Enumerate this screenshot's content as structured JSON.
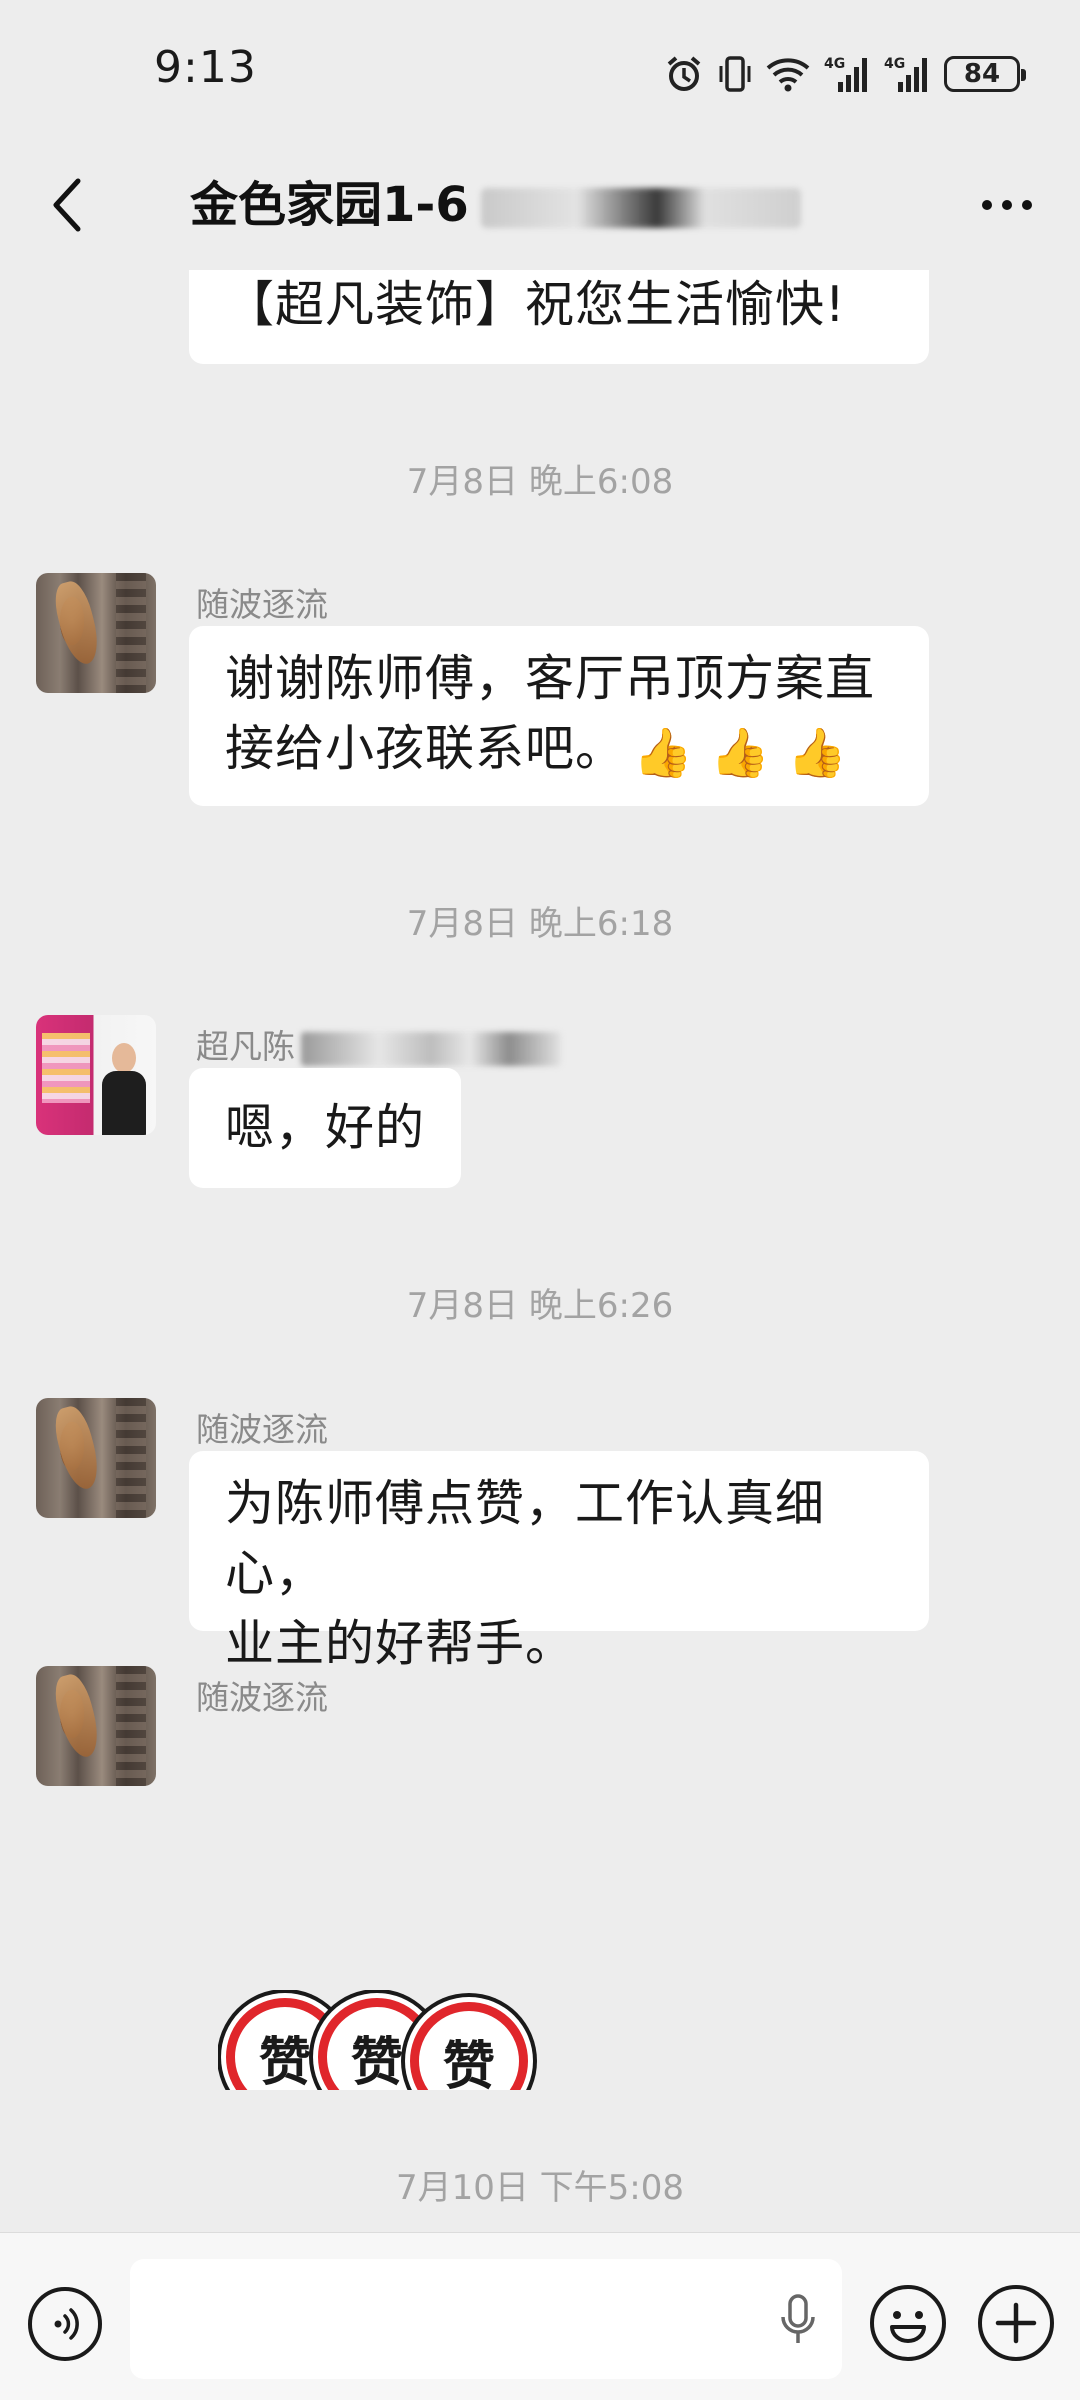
{
  "status_bar": {
    "time": "9:13",
    "network_1": "4G",
    "network_2": "4G",
    "battery": "84"
  },
  "header": {
    "title": "金色家园1-6",
    "back_icon": "chevron-left-icon",
    "more_icon": "more-dots-icon"
  },
  "messages": [
    {
      "type": "text",
      "text": "【超凡装饰】祝您生活愉快!"
    },
    {
      "type": "timestamp",
      "text": "7月8日 晚上6:08"
    },
    {
      "type": "text",
      "sender": "随波逐流",
      "text_line1": "谢谢陈师傅，客厅吊顶方案直",
      "text_line2": "接给小孩联系吧。",
      "emoji": "👍 👍 👍"
    },
    {
      "type": "timestamp",
      "text": "7月8日 晚上6:18"
    },
    {
      "type": "text",
      "sender": "超凡陈",
      "text": "嗯，好的"
    },
    {
      "type": "timestamp",
      "text": "7月8日 晚上6:26"
    },
    {
      "type": "text",
      "sender": "随波逐流",
      "text_line1": "为陈师傅点赞，工作认真细心，",
      "text_line2": "业主的好帮手。"
    },
    {
      "type": "sticker",
      "sender": "随波逐流",
      "sticker_text": "赞"
    },
    {
      "type": "timestamp",
      "text": "7月10日 下午5:08"
    }
  ],
  "input_bar": {
    "voice_icon": "voice-icon",
    "mic_icon": "mic-icon",
    "emoji_icon": "emoji-icon",
    "plus_icon": "plus-icon"
  }
}
